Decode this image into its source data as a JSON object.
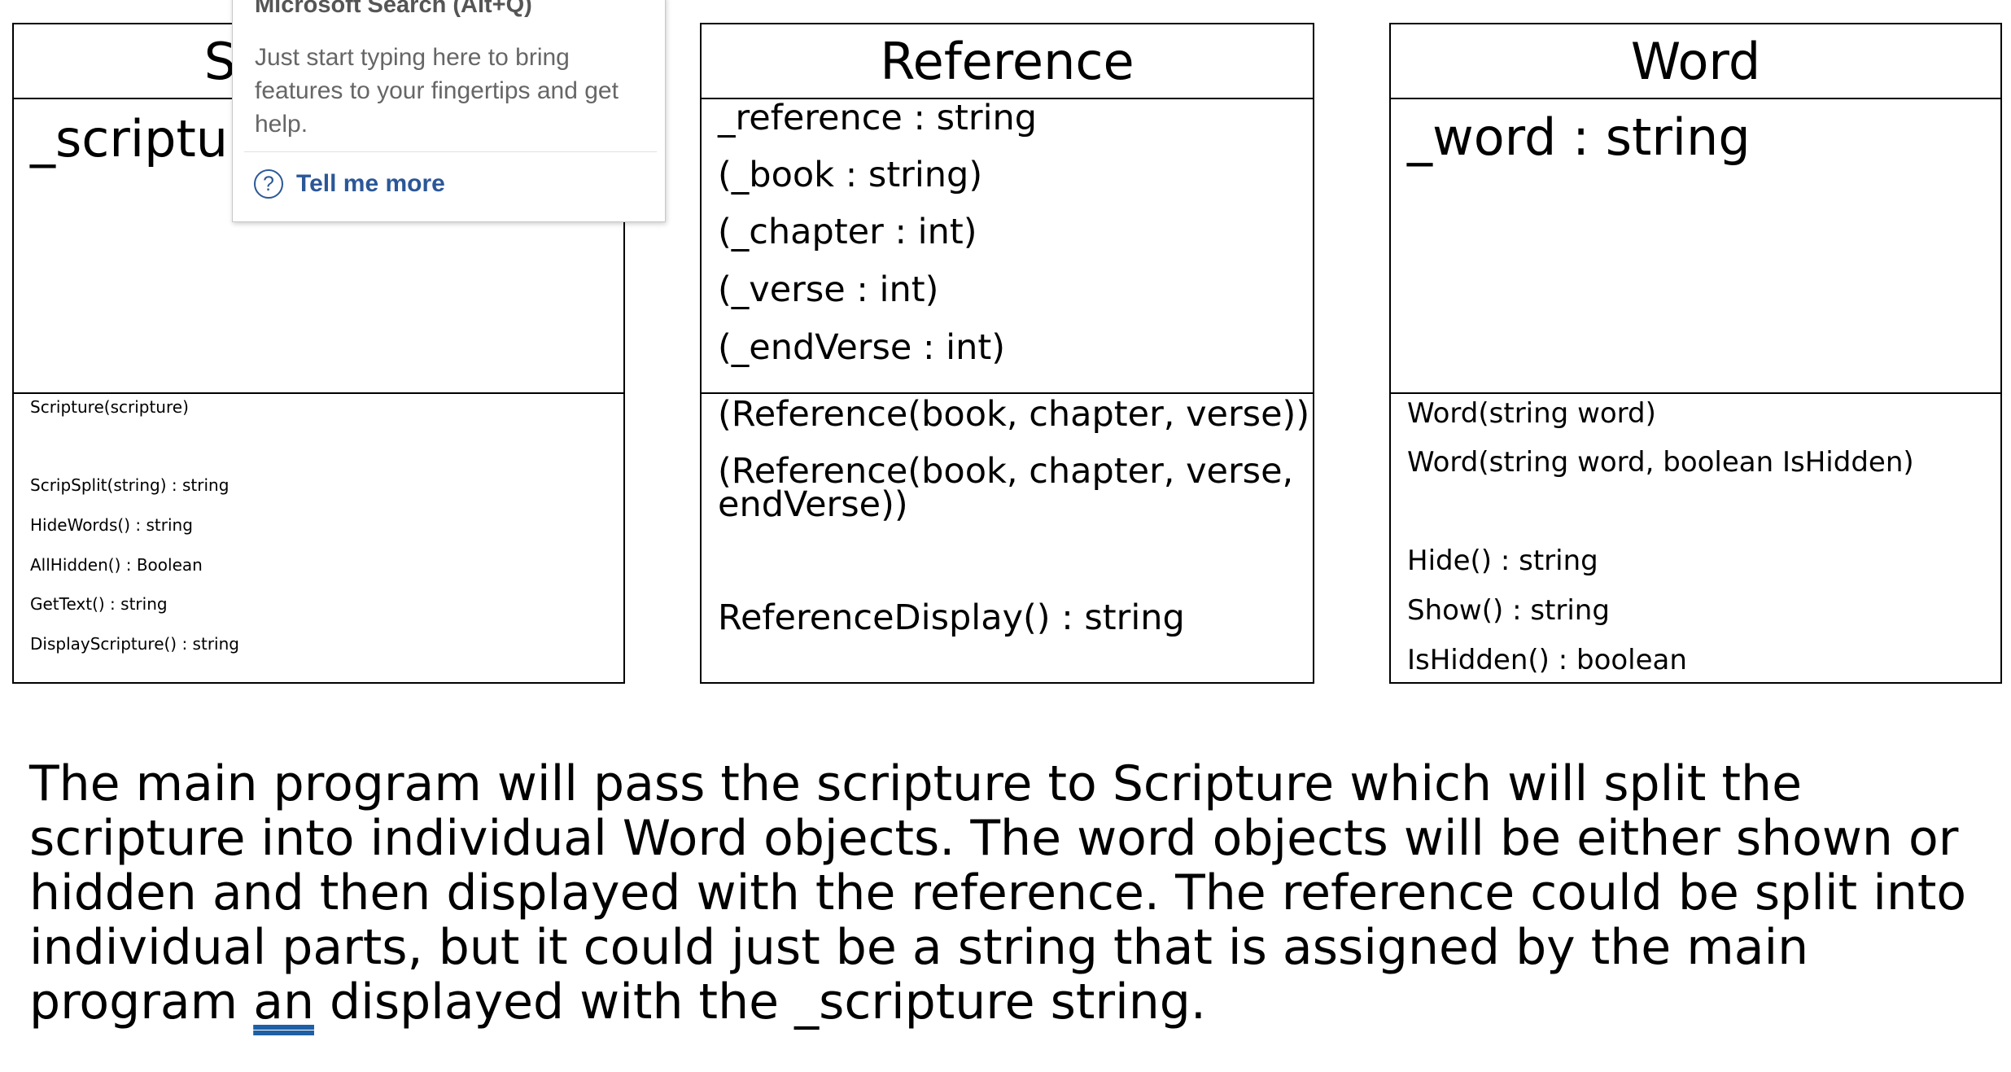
{
  "diagram": {
    "scripture": {
      "title": "Scripture",
      "attribute": "_scripture",
      "methods": [
        "Scripture(scripture)",
        "ScripSplit(string) : string",
        "HideWords() : string",
        "AllHidden() : Boolean",
        "GetText() : string",
        "DisplayScripture() : string"
      ]
    },
    "reference": {
      "title": "Reference",
      "attributes": [
        "_reference : string",
        "(_book : string)",
        "(_chapter : int)",
        "(_verse : int)",
        "(_endVerse : int)"
      ],
      "methods": [
        "(Reference(book, chapter, verse))",
        "(Reference(book, chapter, verse,",
        "endVerse))",
        "ReferenceDisplay() : string"
      ]
    },
    "word": {
      "title": "Word",
      "attribute": "_word : string",
      "methods": [
        "Word(string word)",
        "Word(string word, boolean IsHidden)",
        "Hide() : string",
        "Show() : string",
        "IsHidden() : boolean"
      ]
    }
  },
  "description": {
    "text_before": "The main program will pass the scripture to Scripture which will split the scripture into individual Word objects. The word objects will be either shown or hidden and then displayed with the reference. The reference could be split into individual parts, but it could just be a string that is assigned by the main program ",
    "flagged_word": "an",
    "text_after": " displayed with the _scripture string."
  },
  "search_popup": {
    "title": "Microsoft Search (Alt+Q)",
    "body": "Just start typing here to bring features to your fingertips and get help.",
    "link_label": "Tell me more",
    "link_icon": "help-icon",
    "link_color": "#2b5797"
  }
}
